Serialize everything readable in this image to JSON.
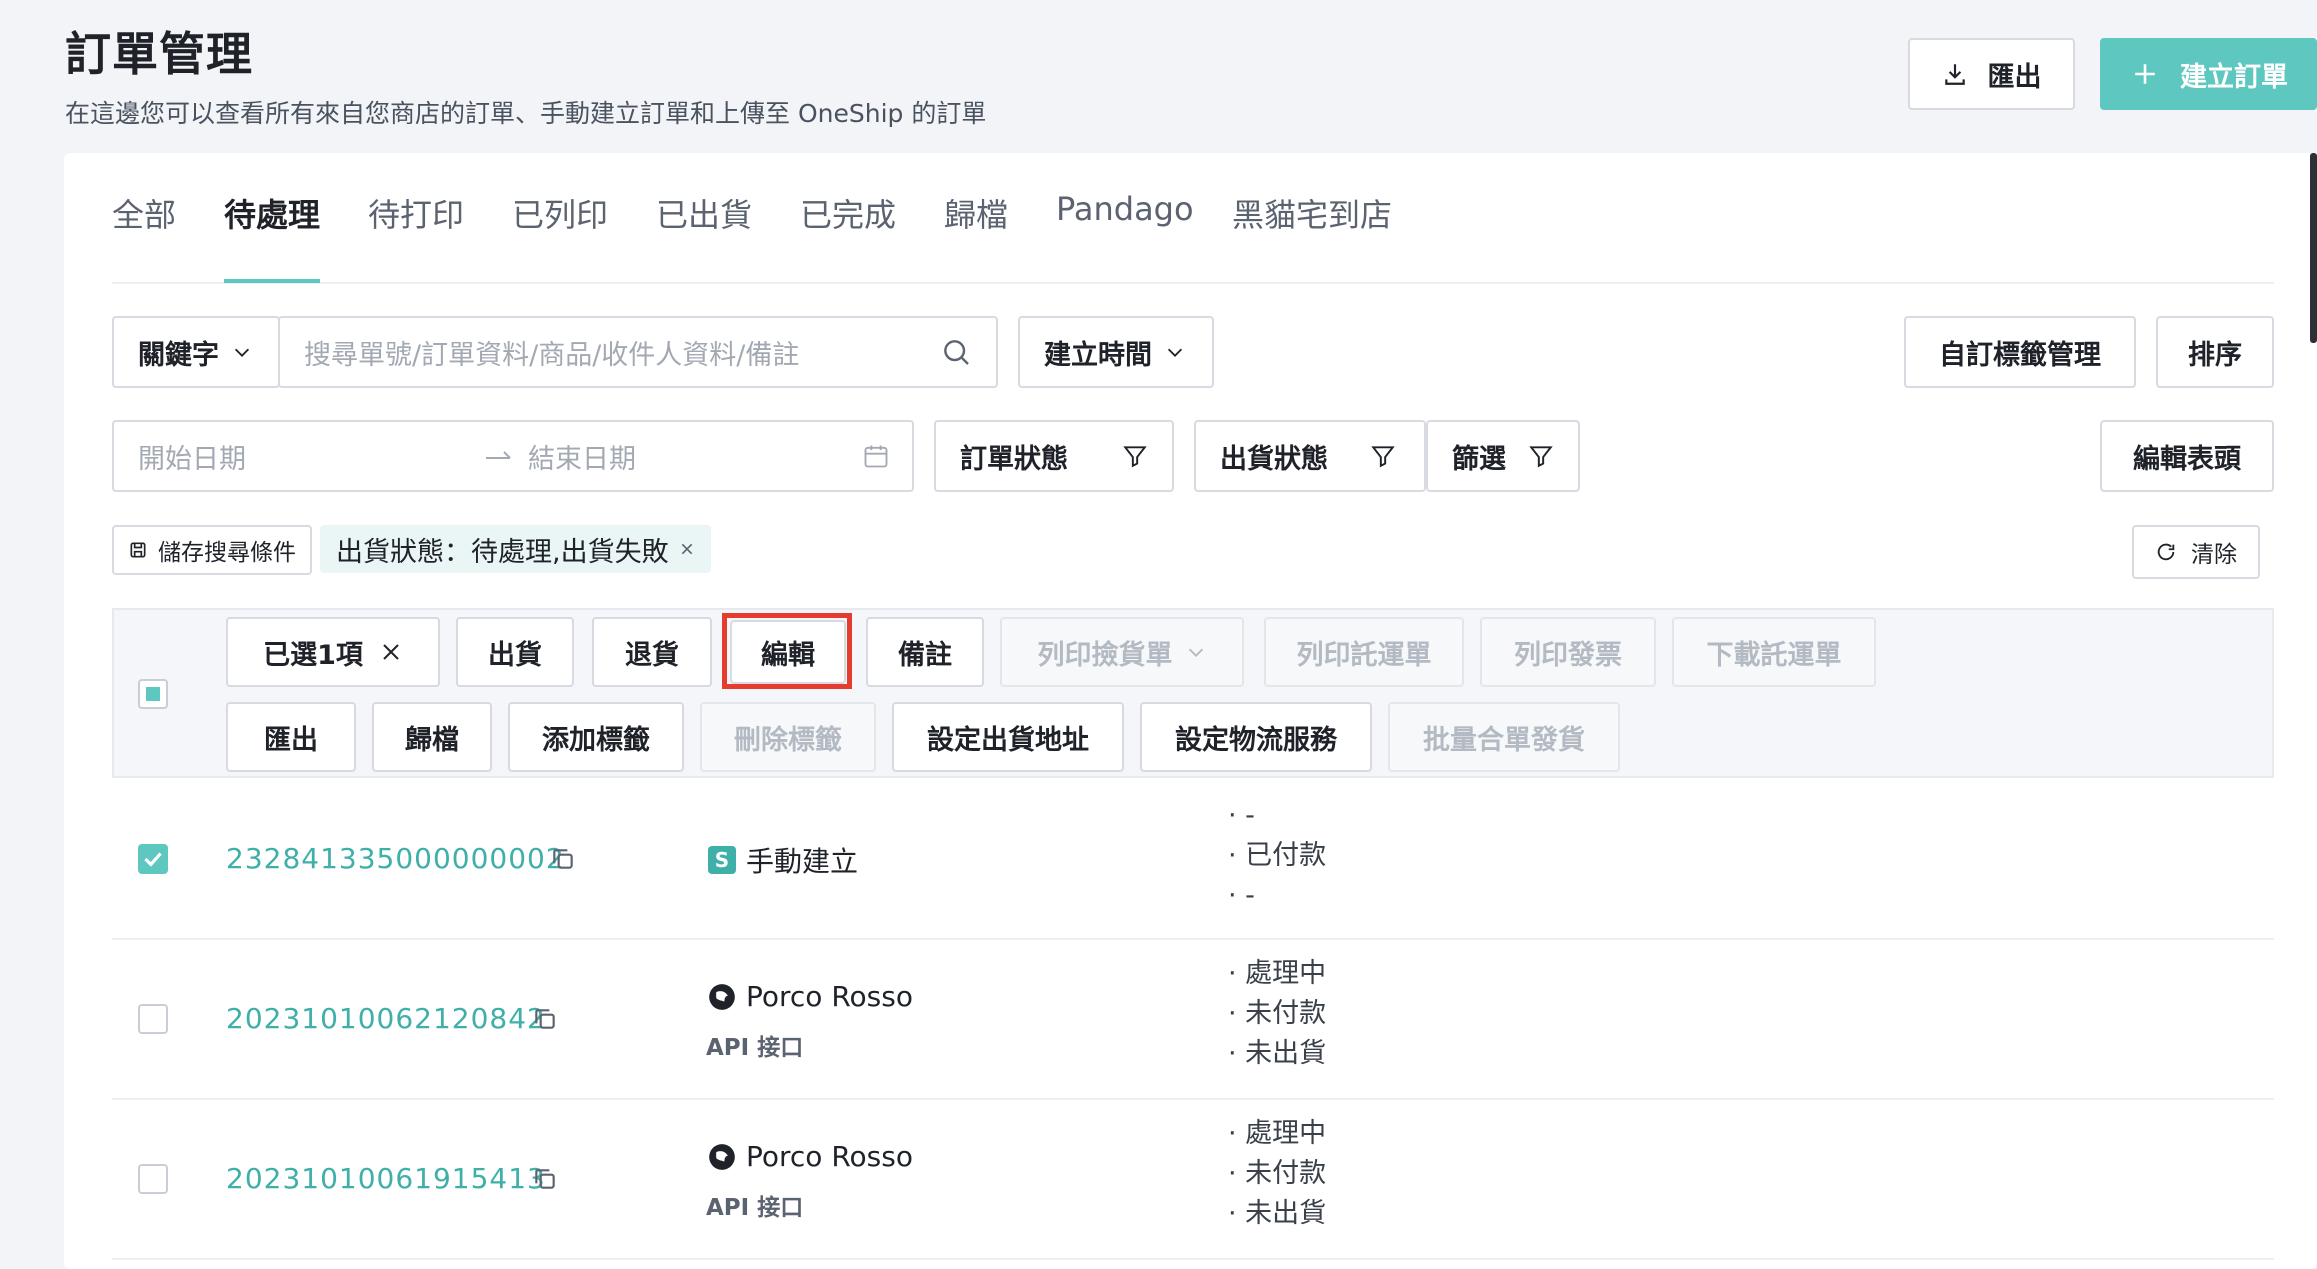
{
  "header": {
    "title": "訂單管理",
    "subtitle": "在這邊您可以查看所有來自您商店的訂單、手動建立訂單和上傳至 OneShip 的訂單",
    "export_label": "匯出",
    "create_label": "建立訂單"
  },
  "tabs": [
    "全部",
    "待處理",
    "待打印",
    "已列印",
    "已出貨",
    "已完成",
    "歸檔",
    "Pandago",
    "黑貓宅到店"
  ],
  "active_tab": "待處理",
  "filters": {
    "keyword_select": "關鍵字",
    "search_placeholder": "搜尋單號/訂單資料/商品/收件人資料/備註",
    "created_time_select": "建立時間",
    "custom_tag_button": "自訂標籤管理",
    "sort_button": "排序",
    "start_date_placeholder": "開始日期",
    "end_date_placeholder": "結束日期",
    "order_status_filter": "訂單狀態",
    "shipping_status_filter": "出貨狀態",
    "filter_button": "篩選",
    "edit_header_button": "編輯表頭",
    "save_search_button": "儲存搜尋條件",
    "active_chip": "出貨狀態：待處理,出貨失敗",
    "clear_button": "清除"
  },
  "bulk_actions": {
    "selected_label": "已選1項",
    "row1": [
      "出貨",
      "退貨",
      "編輯",
      "備註",
      "列印撿貨單",
      "列印託運單",
      "列印發票",
      "下載託運單"
    ],
    "row2": [
      "匯出",
      "歸檔",
      "添加標籤",
      "刪除標籤",
      "設定出貨地址",
      "設定物流服務",
      "批量合單發貨"
    ]
  },
  "orders": [
    {
      "id": "232841335000000002",
      "source": "手動建立",
      "sub_source": "",
      "status": [
        "-",
        "已付款",
        "-"
      ],
      "checked": true
    },
    {
      "id": "20231010062120842",
      "source": "Porco Rosso",
      "sub_source": "API 接口",
      "status": [
        "處理中",
        "未付款",
        "未出貨"
      ],
      "checked": false
    },
    {
      "id": "20231010061915413",
      "source": "Porco Rosso",
      "sub_source": "API 接口",
      "status": [
        "處理中",
        "未付款",
        "未出貨"
      ],
      "checked": false
    }
  ],
  "colors": {
    "accent": "#5ec7c0",
    "highlight": "#e43d2f"
  }
}
